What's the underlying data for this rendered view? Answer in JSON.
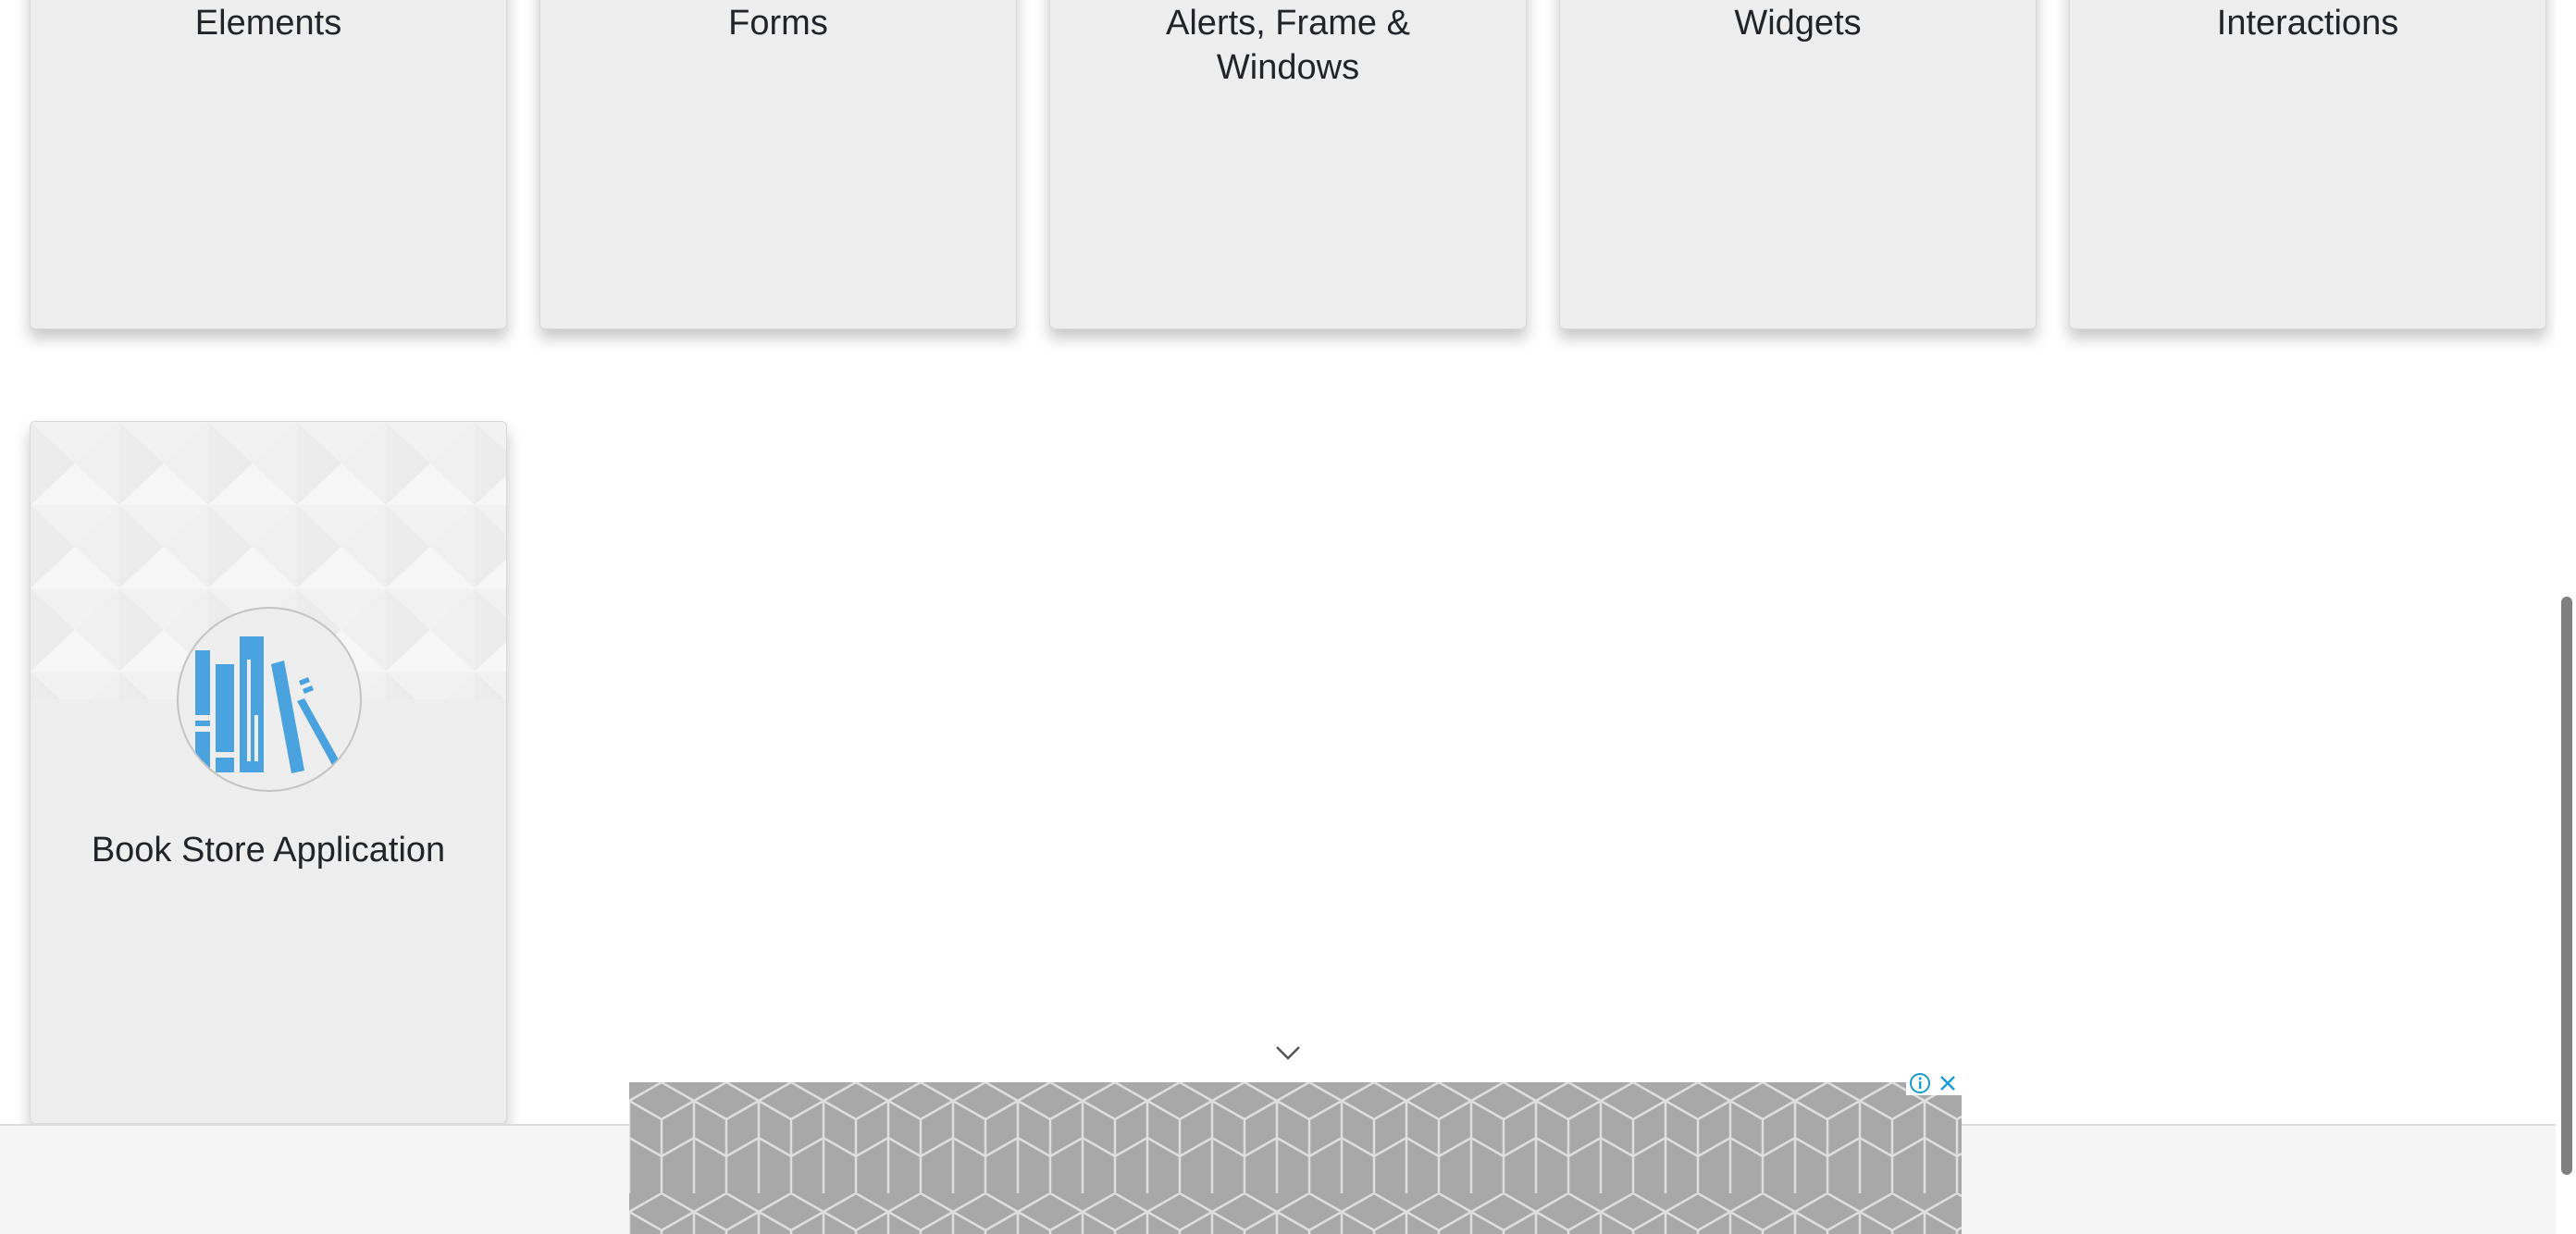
{
  "cards": [
    {
      "title": "Elements",
      "icon": "elements-icon"
    },
    {
      "title": "Forms",
      "icon": "forms-icon"
    },
    {
      "title": "Alerts, Frame &\nWindows",
      "icon": "alerts-icon"
    },
    {
      "title": "Widgets",
      "icon": "widgets-icon"
    },
    {
      "title": "Interactions",
      "icon": "interactions-icon"
    }
  ],
  "book_store": {
    "title": "Book Store Application",
    "icon": "books-icon",
    "icon_color": "#4aa3df"
  },
  "ad": {
    "collapse_icon": "chevron-down-icon",
    "info_icon": "info-icon",
    "close_icon": "close-icon",
    "accent": "#1a9ad6"
  }
}
